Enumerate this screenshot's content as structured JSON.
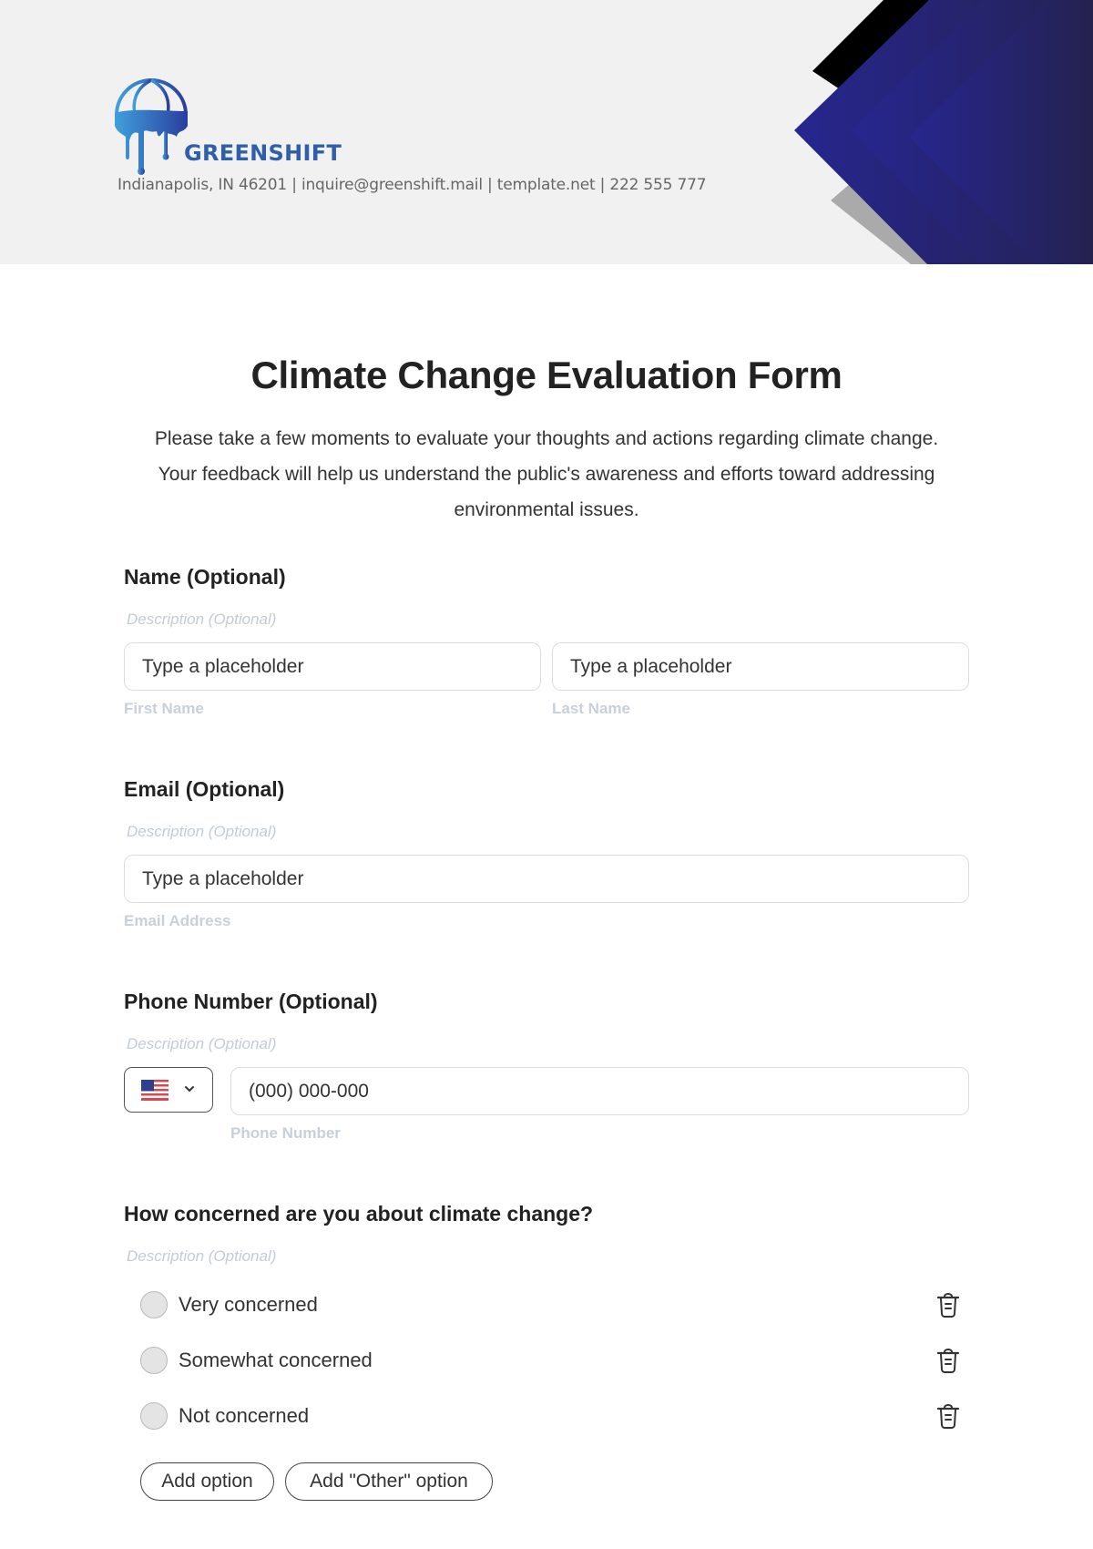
{
  "header": {
    "brand_name": "GREENSHIFT",
    "contact_line": "Indianapolis, IN 46201 | inquire@greenshift.mail | template.net | 222 555 777",
    "logo_icon": "globe-drip-logo-icon",
    "colors": {
      "background": "#f1f1f1",
      "brand_text": "#2f5fa8",
      "deco_navy": "#252586",
      "deco_dark": "#242050",
      "deco_black": "#000000",
      "deco_gray": "#aaaaaa"
    }
  },
  "form": {
    "title": "Climate Change Evaluation Form",
    "intro": "Please take a few moments to evaluate your thoughts and actions regarding climate change. Your feedback will help us understand the public's awareness and efforts toward addressing environmental issues.",
    "fields": {
      "name": {
        "label": "Name (Optional)",
        "description": "Description (Optional)",
        "first": {
          "placeholder": "Type a placeholder",
          "sublabel": "First Name"
        },
        "last": {
          "placeholder": "Type a placeholder",
          "sublabel": "Last Name"
        }
      },
      "email": {
        "label": "Email (Optional)",
        "description": "Description (Optional)",
        "placeholder": "Type a placeholder",
        "sublabel": "Email Address"
      },
      "phone": {
        "label": "Phone Number (Optional)",
        "description": "Description (Optional)",
        "country_icon": "us-flag-icon",
        "placeholder": "(000) 000-000",
        "sublabel": "Phone Number"
      },
      "concern": {
        "label": "How concerned are you about climate change?",
        "description": "Description (Optional)",
        "options": [
          {
            "label": "Very concerned",
            "selected": false
          },
          {
            "label": "Somewhat concerned",
            "selected": false
          },
          {
            "label": "Not concerned",
            "selected": false
          }
        ],
        "add_option_label": "Add option",
        "add_other_label": "Add \"Other\" option"
      }
    }
  }
}
